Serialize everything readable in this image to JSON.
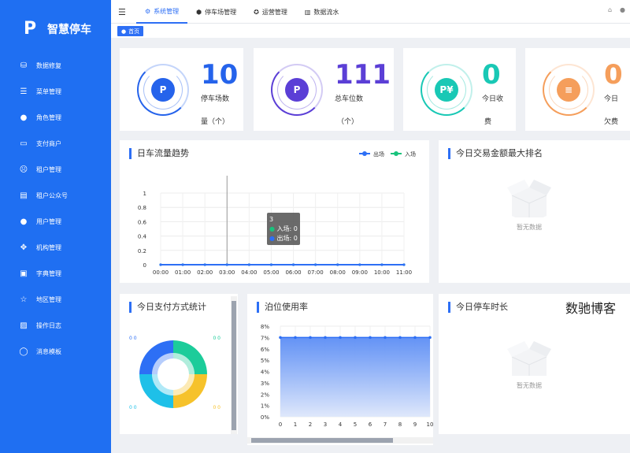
{
  "brand": {
    "logo_letter": "P",
    "logo_sub": "🚗",
    "title": "智慧停车"
  },
  "sidebar": {
    "items": [
      {
        "label": "数据修复",
        "icon": "database-icon",
        "glyph": "⛁"
      },
      {
        "label": "菜单管理",
        "icon": "sliders-icon",
        "glyph": "☰"
      },
      {
        "label": "角色管理",
        "icon": "user-icon",
        "glyph": "●"
      },
      {
        "label": "支付商户",
        "icon": "wallet-icon",
        "glyph": "▭"
      },
      {
        "label": "租户管理",
        "icon": "tenant-icon",
        "glyph": "☹"
      },
      {
        "label": "租户公众号",
        "icon": "chat-icon",
        "glyph": "▤"
      },
      {
        "label": "用户管理",
        "icon": "user-icon",
        "glyph": "●"
      },
      {
        "label": "机构管理",
        "icon": "org-icon",
        "glyph": "✥"
      },
      {
        "label": "字典管理",
        "icon": "book-icon",
        "glyph": "▣"
      },
      {
        "label": "地区管理",
        "icon": "star-icon",
        "glyph": "☆"
      },
      {
        "label": "操作日志",
        "icon": "log-icon",
        "glyph": "▨"
      },
      {
        "label": "消息模板",
        "icon": "message-icon",
        "glyph": "◯"
      }
    ]
  },
  "header": {
    "tabs": [
      {
        "label": "系统管理",
        "icon": "gear-icon",
        "glyph": "⚙",
        "active": true
      },
      {
        "label": "停车场管理",
        "icon": "parking-icon",
        "glyph": "⬢",
        "active": false
      },
      {
        "label": "运营管理",
        "icon": "settings-icon",
        "glyph": "✪",
        "active": false
      },
      {
        "label": "数据流水",
        "icon": "chart-icon",
        "glyph": "▥",
        "active": false
      }
    ]
  },
  "breadcrumb": {
    "label": "首页"
  },
  "stats": [
    {
      "value": "10",
      "label1": "停车场数",
      "label2": "量（个）",
      "color": "#2563eb",
      "icon_glyph": "P"
    },
    {
      "value": "111",
      "label1": "总车位数",
      "label2": "（个）",
      "color": "#5b3fd6",
      "icon_glyph": "P"
    },
    {
      "value": "0",
      "label1": "今日收",
      "label2": "费",
      "color": "#19c8b5",
      "icon_glyph": "P¥"
    },
    {
      "value": "0",
      "label1": "今日",
      "label2": "欠费",
      "color": "#f59e5b",
      "icon_glyph": "≡"
    }
  ],
  "panels": {
    "traffic": {
      "title": "日车流量趋势"
    },
    "ranking": {
      "title": "今日交易金额最大排名",
      "empty": "暂无数据"
    },
    "payment": {
      "title": "今日支付方式统计"
    },
    "occupancy": {
      "title": "泊位使用率"
    },
    "duration": {
      "title": "今日停车时长",
      "empty": "暂无数据"
    }
  },
  "tooltip": {
    "title": "3",
    "rows": [
      {
        "label": "入场: 0",
        "color": "#19c37d"
      },
      {
        "label": "出场: 0",
        "color": "#2d6ff5"
      }
    ]
  },
  "watermark": "数驰博客",
  "colors": {
    "primary": "#2d6ff5",
    "sidebar": "#1f6ff2",
    "out": "#2d6ff5",
    "in": "#19c37d"
  },
  "chart_data": [
    {
      "type": "line",
      "title": "日车流量趋势",
      "x": [
        "00:00",
        "01:00",
        "02:00",
        "03:00",
        "04:00",
        "05:00",
        "06:00",
        "07:00",
        "08:00",
        "09:00",
        "10:00",
        "11:00"
      ],
      "series": [
        {
          "name": "出场",
          "values": [
            0,
            0,
            0,
            0,
            0,
            0,
            0,
            0,
            0,
            0,
            0,
            0
          ]
        },
        {
          "name": "入场",
          "values": [
            0,
            0,
            0,
            0,
            0,
            0,
            0,
            0,
            0,
            0,
            0,
            0
          ]
        }
      ],
      "yticks": [
        "0",
        "0.2",
        "0.4",
        "0.6",
        "0.8",
        "1"
      ],
      "ylim": [
        0,
        1
      ],
      "legend": "top-right",
      "grid": true
    },
    {
      "type": "area",
      "title": "泊位使用率",
      "x": [
        "0",
        "1",
        "2",
        "3",
        "4",
        "5",
        "6",
        "7",
        "8",
        "9",
        "10"
      ],
      "series": [
        {
          "values": [
            7,
            7,
            7,
            7,
            7,
            7,
            7,
            7,
            7,
            7,
            7
          ]
        }
      ],
      "yticks": [
        "0%",
        "1%",
        "2%",
        "3%",
        "4%",
        "5%",
        "6%",
        "7%",
        "8%"
      ],
      "ylim": [
        0,
        8
      ],
      "grid": true
    },
    {
      "type": "pie",
      "title": "今日支付方式统计",
      "labels": [
        "0 0",
        "0 0",
        "0 0",
        "0 0"
      ],
      "values": [
        1,
        1,
        1,
        1
      ],
      "colors": [
        "#1ccc9a",
        "#f6c22b",
        "#1ec0e8",
        "#2d6ff5"
      ]
    }
  ]
}
